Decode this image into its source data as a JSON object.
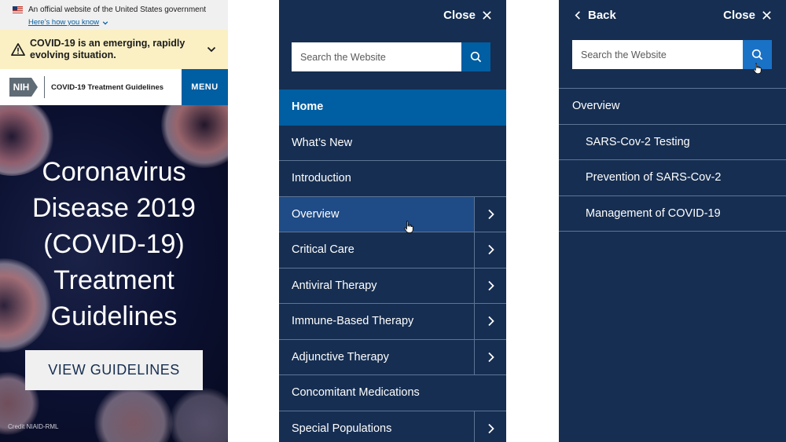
{
  "gov_banner": {
    "text": "An official website of the United States government",
    "link": "Here’s how you know"
  },
  "alert": {
    "text": "COVID-19 is an emerging, rapidly evolving situation."
  },
  "header": {
    "logo": "NIH",
    "site_name": "COVID-19 Treatment Guidelines",
    "menu_label": "MENU"
  },
  "hero": {
    "title": "Coronavirus Disease 2019 (COVID-19) Treatment Guidelines",
    "button_label": "VIEW GUIDELINES",
    "credit": "Credit NIAID-RML"
  },
  "main_menu": {
    "close_label": "Close",
    "search_placeholder": "Search the Website",
    "items": [
      {
        "label": "Home"
      },
      {
        "label": "What’s New"
      },
      {
        "label": "Introduction"
      },
      {
        "label": "Overview"
      },
      {
        "label": "Critical Care"
      },
      {
        "label": "Antiviral Therapy"
      },
      {
        "label": "Immune-Based Therapy"
      },
      {
        "label": "Adjunctive Therapy"
      },
      {
        "label": "Concomitant Medications"
      },
      {
        "label": "Special Populations"
      }
    ]
  },
  "sub_menu": {
    "back_label": "Back",
    "close_label": "Close",
    "search_placeholder": "Search the Website",
    "parent": "Overview",
    "items": [
      {
        "label": "SARS-Cov-2 Testing"
      },
      {
        "label": "Prevention of SARS-Cov-2"
      },
      {
        "label": "Management of COVID-19"
      }
    ]
  },
  "colors": {
    "navy": "#162e51",
    "primary_blue": "#005ea2",
    "alert_yellow": "#faf0c4",
    "divider": "#5d7595"
  }
}
